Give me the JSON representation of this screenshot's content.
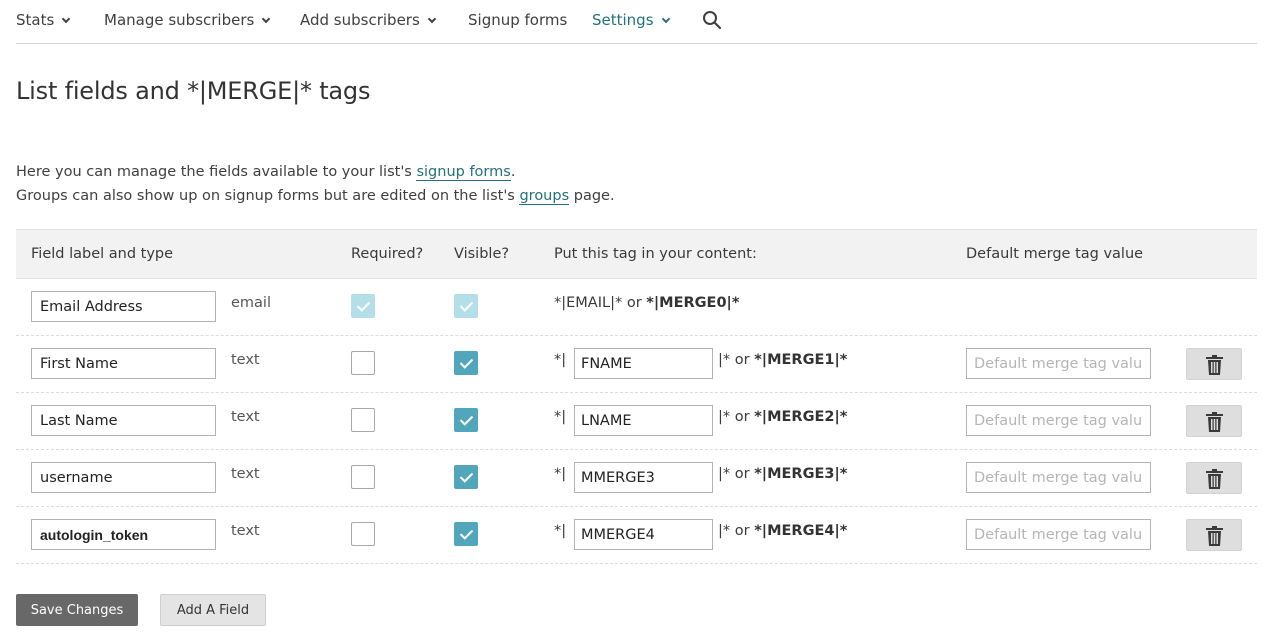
{
  "nav": {
    "items": [
      {
        "label": "Stats"
      },
      {
        "label": "Manage subscribers"
      },
      {
        "label": "Add subscribers"
      },
      {
        "label": "Signup forms"
      },
      {
        "label": "Settings"
      }
    ]
  },
  "page": {
    "title": "List fields and *|MERGE|* tags"
  },
  "intro": {
    "line1_before": "Here you can manage the fields available to your list's ",
    "line1_link": "signup forms",
    "line1_after": ".",
    "line2_before": "Groups can also show up on signup forms but are edited on the list's ",
    "line2_link": "groups",
    "line2_after": " page."
  },
  "table": {
    "headers": {
      "label": "Field label and type",
      "required": "Required?",
      "visible": "Visible?",
      "tag": "Put this tag in your content:",
      "default": "Default merge tag value"
    },
    "email_row": {
      "label": "Email Address",
      "type": "email",
      "tag_plain": "*|EMAIL|* or ",
      "tag_bold": "*|MERGE0|*"
    },
    "tag_prefix": "*|",
    "suffix_plain": "|* or ",
    "default_placeholder": "Default merge tag value",
    "rows": [
      {
        "label": "First Name",
        "type": "text",
        "tag": "FNAME",
        "merge": "*|MERGE1|*"
      },
      {
        "label": "Last Name",
        "type": "text",
        "tag": "LNAME",
        "merge": "*|MERGE2|*"
      },
      {
        "label": "username",
        "type": "text",
        "tag": "MMERGE3",
        "merge": "*|MERGE3|*"
      },
      {
        "label": "autologin_token",
        "type": "text",
        "tag": "MMERGE4",
        "merge": "*|MERGE4|*"
      }
    ]
  },
  "buttons": {
    "save": "Save Changes",
    "add": "Add A Field"
  },
  "colors": {
    "accent": "#24717c",
    "checkbox": "#52a6bc",
    "checkbox_disabled": "#b4dfe8"
  }
}
